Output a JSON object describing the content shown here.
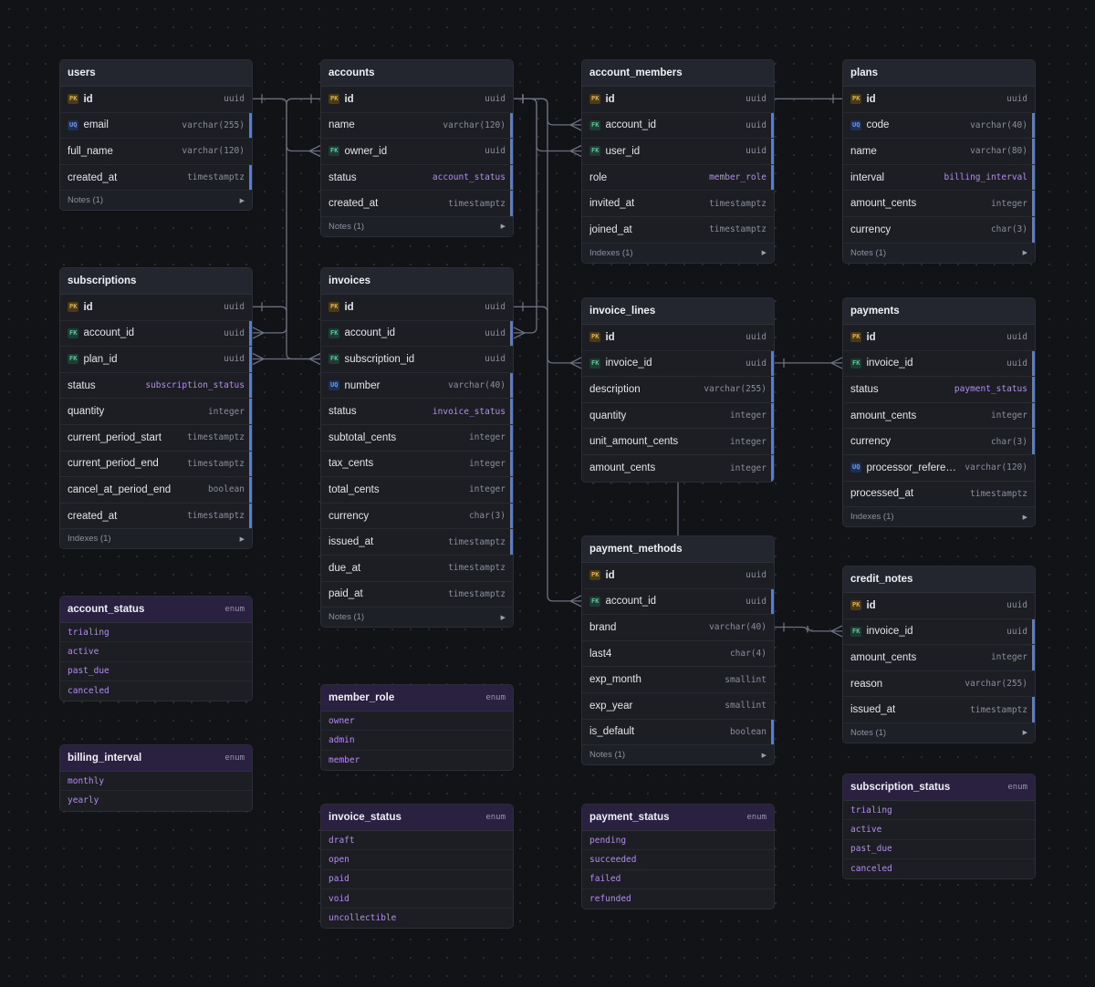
{
  "tables": [
    {
      "id": "users",
      "name": "users",
      "footer": "Notes (1)",
      "columns": [
        {
          "name": "id",
          "type": "uuid",
          "badge": "PK"
        },
        {
          "name": "email",
          "type": "varchar(255)",
          "badge": "UQ",
          "hl": true
        },
        {
          "name": "full_name",
          "type": "varchar(120)",
          "badge": ""
        },
        {
          "name": "created_at",
          "type": "timestamptz",
          "badge": "",
          "hl": true
        }
      ]
    },
    {
      "id": "accounts",
      "name": "accounts",
      "footer": "Notes (1)",
      "columns": [
        {
          "name": "id",
          "type": "uuid",
          "badge": "PK"
        },
        {
          "name": "name",
          "type": "varchar(120)",
          "badge": "",
          "hl": true
        },
        {
          "name": "owner_id",
          "type": "uuid",
          "badge": "FK",
          "hl": true
        },
        {
          "name": "status",
          "type": "account_status",
          "badge": "",
          "enum": true,
          "hl": true
        },
        {
          "name": "created_at",
          "type": "timestamptz",
          "badge": "",
          "hl": true
        }
      ]
    },
    {
      "id": "account_members",
      "name": "account_members",
      "footer": "Indexes (1)",
      "columns": [
        {
          "name": "id",
          "type": "uuid",
          "badge": "PK"
        },
        {
          "name": "account_id",
          "type": "uuid",
          "badge": "FK",
          "hl": true
        },
        {
          "name": "user_id",
          "type": "uuid",
          "badge": "FK",
          "hl": true
        },
        {
          "name": "role",
          "type": "member_role",
          "badge": "",
          "enum": true,
          "hl": true
        },
        {
          "name": "invited_at",
          "type": "timestamptz",
          "badge": ""
        },
        {
          "name": "joined_at",
          "type": "timestamptz",
          "badge": ""
        }
      ]
    },
    {
      "id": "plans",
      "name": "plans",
      "footer": "Notes (1)",
      "columns": [
        {
          "name": "id",
          "type": "uuid",
          "badge": "PK"
        },
        {
          "name": "code",
          "type": "varchar(40)",
          "badge": "UQ",
          "hl": true
        },
        {
          "name": "name",
          "type": "varchar(80)",
          "badge": "",
          "hl": true
        },
        {
          "name": "interval",
          "type": "billing_interval",
          "badge": "",
          "enum": true,
          "hl": true
        },
        {
          "name": "amount_cents",
          "type": "integer",
          "badge": "",
          "hl": true
        },
        {
          "name": "currency",
          "type": "char(3)",
          "badge": "",
          "hl": true
        }
      ]
    },
    {
      "id": "subscriptions",
      "name": "subscriptions",
      "footer": "Indexes (1)",
      "columns": [
        {
          "name": "id",
          "type": "uuid",
          "badge": "PK"
        },
        {
          "name": "account_id",
          "type": "uuid",
          "badge": "FK",
          "hl": true
        },
        {
          "name": "plan_id",
          "type": "uuid",
          "badge": "FK",
          "hl": true
        },
        {
          "name": "status",
          "type": "subscription_status",
          "badge": "",
          "enum": true,
          "hl": true
        },
        {
          "name": "quantity",
          "type": "integer",
          "badge": "",
          "hl": true
        },
        {
          "name": "current_period_start",
          "type": "timestamptz",
          "badge": "",
          "hl": true
        },
        {
          "name": "current_period_end",
          "type": "timestamptz",
          "badge": "",
          "hl": true
        },
        {
          "name": "cancel_at_period_end",
          "type": "boolean",
          "badge": "",
          "hl": true
        },
        {
          "name": "created_at",
          "type": "timestamptz",
          "badge": "",
          "hl": true
        }
      ]
    },
    {
      "id": "invoices",
      "name": "invoices",
      "footer": "Notes (1)",
      "columns": [
        {
          "name": "id",
          "type": "uuid",
          "badge": "PK"
        },
        {
          "name": "account_id",
          "type": "uuid",
          "badge": "FK",
          "hl": true
        },
        {
          "name": "subscription_id",
          "type": "uuid",
          "badge": "FK"
        },
        {
          "name": "number",
          "type": "varchar(40)",
          "badge": "UQ",
          "hl": true
        },
        {
          "name": "status",
          "type": "invoice_status",
          "badge": "",
          "enum": true,
          "hl": true
        },
        {
          "name": "subtotal_cents",
          "type": "integer",
          "badge": "",
          "hl": true
        },
        {
          "name": "tax_cents",
          "type": "integer",
          "badge": "",
          "hl": true
        },
        {
          "name": "total_cents",
          "type": "integer",
          "badge": "",
          "hl": true
        },
        {
          "name": "currency",
          "type": "char(3)",
          "badge": "",
          "hl": true
        },
        {
          "name": "issued_at",
          "type": "timestamptz",
          "badge": "",
          "hl": true
        },
        {
          "name": "due_at",
          "type": "timestamptz",
          "badge": ""
        },
        {
          "name": "paid_at",
          "type": "timestamptz",
          "badge": ""
        }
      ]
    },
    {
      "id": "invoice_lines",
      "name": "invoice_lines",
      "footer": "",
      "columns": [
        {
          "name": "id",
          "type": "uuid",
          "badge": "PK"
        },
        {
          "name": "invoice_id",
          "type": "uuid",
          "badge": "FK",
          "hl": true
        },
        {
          "name": "description",
          "type": "varchar(255)",
          "badge": "",
          "hl": true
        },
        {
          "name": "quantity",
          "type": "integer",
          "badge": "",
          "hl": true
        },
        {
          "name": "unit_amount_cents",
          "type": "integer",
          "badge": "",
          "hl": true
        },
        {
          "name": "amount_cents",
          "type": "integer",
          "badge": "",
          "hl": true
        }
      ]
    },
    {
      "id": "payments",
      "name": "payments",
      "footer": "Indexes (1)",
      "columns": [
        {
          "name": "id",
          "type": "uuid",
          "badge": "PK"
        },
        {
          "name": "invoice_id",
          "type": "uuid",
          "badge": "FK",
          "hl": true
        },
        {
          "name": "status",
          "type": "payment_status",
          "badge": "",
          "enum": true,
          "hl": true
        },
        {
          "name": "amount_cents",
          "type": "integer",
          "badge": "",
          "hl": true
        },
        {
          "name": "currency",
          "type": "char(3)",
          "badge": "",
          "hl": true
        },
        {
          "name": "processor_referen…",
          "type": "varchar(120)",
          "badge": "UQ"
        },
        {
          "name": "processed_at",
          "type": "timestamptz",
          "badge": ""
        }
      ]
    },
    {
      "id": "payment_methods",
      "name": "payment_methods",
      "footer": "Notes (1)",
      "columns": [
        {
          "name": "id",
          "type": "uuid",
          "badge": "PK"
        },
        {
          "name": "account_id",
          "type": "uuid",
          "badge": "FK",
          "hl": true
        },
        {
          "name": "brand",
          "type": "varchar(40)",
          "badge": ""
        },
        {
          "name": "last4",
          "type": "char(4)",
          "badge": ""
        },
        {
          "name": "exp_month",
          "type": "smallint",
          "badge": ""
        },
        {
          "name": "exp_year",
          "type": "smallint",
          "badge": ""
        },
        {
          "name": "is_default",
          "type": "boolean",
          "badge": "",
          "hl": true
        }
      ]
    },
    {
      "id": "credit_notes",
      "name": "credit_notes",
      "footer": "Notes (1)",
      "columns": [
        {
          "name": "id",
          "type": "uuid",
          "badge": "PK"
        },
        {
          "name": "invoice_id",
          "type": "uuid",
          "badge": "FK",
          "hl": true
        },
        {
          "name": "amount_cents",
          "type": "integer",
          "badge": "",
          "hl": true
        },
        {
          "name": "reason",
          "type": "varchar(255)",
          "badge": ""
        },
        {
          "name": "issued_at",
          "type": "timestamptz",
          "badge": "",
          "hl": true
        }
      ]
    }
  ],
  "enums": [
    {
      "id": "account_status",
      "name": "account_status",
      "kw": "enum",
      "values": [
        "trialing",
        "active",
        "past_due",
        "canceled"
      ]
    },
    {
      "id": "billing_interval",
      "name": "billing_interval",
      "kw": "enum",
      "values": [
        "monthly",
        "yearly"
      ]
    },
    {
      "id": "member_role",
      "name": "member_role",
      "kw": "enum",
      "values": [
        "owner",
        "admin",
        "member"
      ]
    },
    {
      "id": "invoice_status",
      "name": "invoice_status",
      "kw": "enum",
      "values": [
        "draft",
        "open",
        "paid",
        "void",
        "uncollectible"
      ]
    },
    {
      "id": "payment_status",
      "name": "payment_status",
      "kw": "enum",
      "values": [
        "pending",
        "succeeded",
        "failed",
        "refunded"
      ]
    },
    {
      "id": "subscription_status",
      "name": "subscription_status",
      "kw": "enum",
      "values": [
        "trialing",
        "active",
        "past_due",
        "canceled"
      ]
    }
  ],
  "colors": {
    "edge": "#6b7080",
    "highlight": "#4f7ee0",
    "pk": "#e6b450",
    "fk": "#5ec99b",
    "uq": "#6f9df0",
    "enum": "#b48cf0"
  }
}
